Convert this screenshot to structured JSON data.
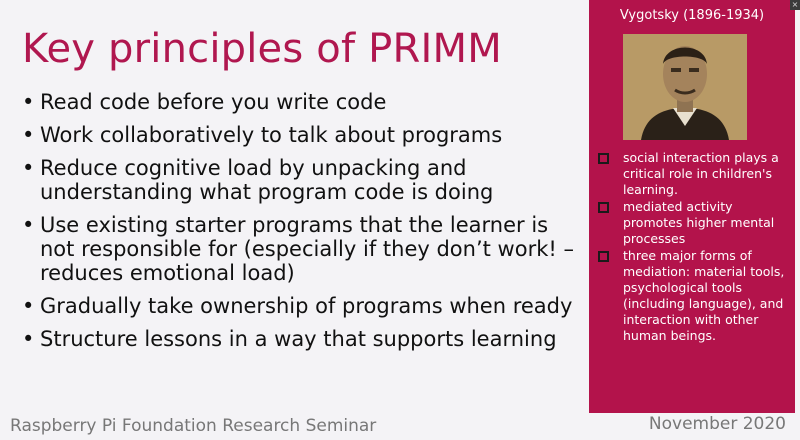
{
  "slide": {
    "title": "Key principles of PRIMM",
    "bullets": [
      "Read code before you write code",
      "Work collaboratively to talk about programs",
      "Reduce cognitive load by unpacking and understanding what program code is doing",
      "Use existing starter programs that the learner is not responsible for (especially if they don’t work! – reduces emotional load)",
      "Gradually take ownership of programs when ready",
      "Structure lessons in a way that supports learning"
    ],
    "bullet_glyph": "•"
  },
  "panel": {
    "title": "Vygotsky (1896-1934)",
    "points": [
      "social interaction plays a critical role in children's learning.",
      "mediated activity promotes higher mental processes",
      "three major forms of mediation: material tools, psychological tools (including language), and interaction with other human beings."
    ]
  },
  "footer": {
    "left": "Raspberry Pi Foundation Research Seminar",
    "right": "November 2020"
  },
  "window": {
    "close_glyph": "×"
  },
  "colors": {
    "title": "#b0174f",
    "panel_bg": "#b3134b",
    "footer_text": "#777777"
  }
}
